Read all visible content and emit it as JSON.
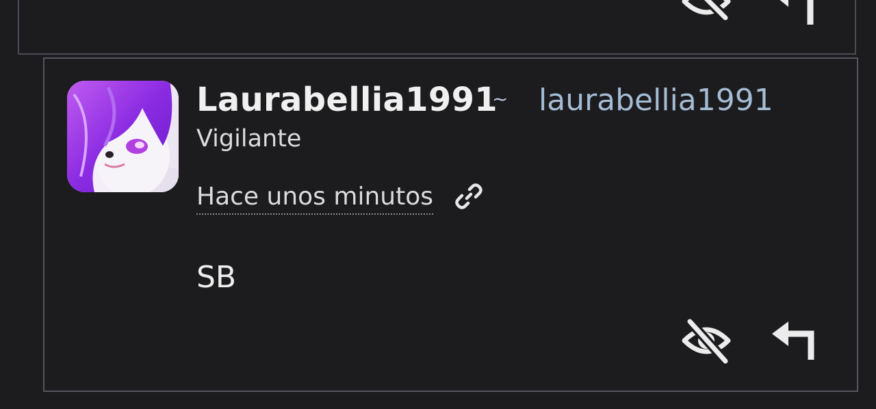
{
  "comment": {
    "author_name": "Laurabellia1991",
    "separator": "~",
    "handle": "laurabellia1991",
    "role": "Vigilante",
    "timestamp": "Hace unos minutos",
    "body": "SB"
  },
  "icons": {
    "permalink": "link-icon",
    "hide": "eye-off-icon",
    "reply": "reply-icon"
  },
  "colors": {
    "background": "#1c1c1e",
    "handle": "#a4bcd4",
    "border": "#55555f",
    "avatar_accent": "#8a2be2"
  }
}
